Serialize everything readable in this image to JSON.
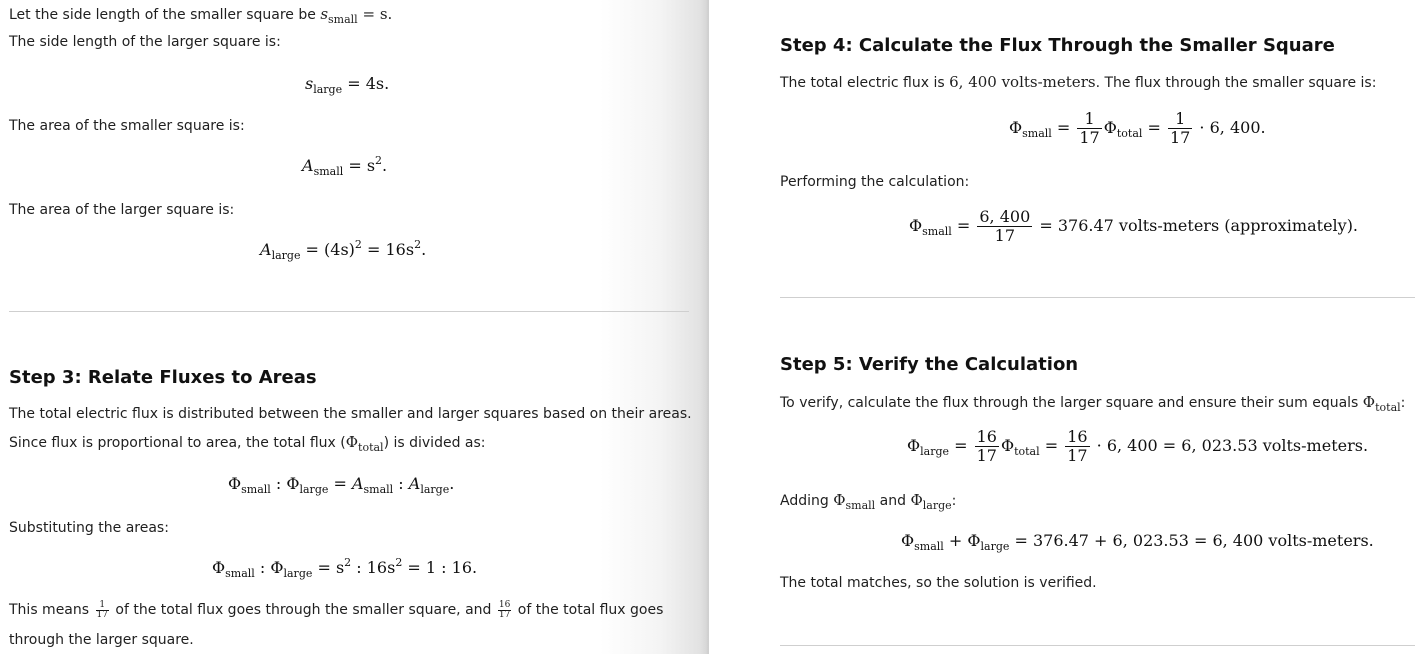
{
  "left_panel": {
    "intro_line1_text": "Let the side length of the smaller square be ",
    "intro_line1_math": {
      "var": "s",
      "sub": "small",
      "rhs": "= s."
    },
    "intro_line2": "The side length of the larger square is:",
    "eq_side_large": {
      "var": "s",
      "sub": "large",
      "rhs": "= 4s."
    },
    "area_small_label": "The area of the smaller square is:",
    "eq_area_small": {
      "var": "A",
      "sub": "small",
      "rhs": "= s",
      "exp": "2",
      "end": "."
    },
    "area_large_label": "The area of the larger square is:",
    "eq_area_large": {
      "var": "A",
      "sub": "large",
      "mid": "= (4s)",
      "exp1": "2",
      "rhs": " = 16s",
      "exp2": "2",
      "end": "."
    },
    "step3": {
      "heading": "Step 3: Relate Fluxes to Areas",
      "para1": "The total electric flux is distributed between the smaller and larger squares based on their areas.",
      "para2_pre": "Since flux is proportional to area, the total flux (",
      "para2_sym": "Φ",
      "para2_sub": "total",
      "para2_post": ") is divided as:",
      "eq_ratio": {
        "phi": "Φ",
        "sub1": "small",
        "colon1": " : ",
        "sub2": "large",
        "eq": " = ",
        "a": "A",
        "sub3": "small",
        "colon2": " : ",
        "sub4": "large",
        "end": "."
      },
      "subst_label": "Substituting the areas:",
      "eq_subst": {
        "phi": "Φ",
        "sub1": "small",
        "colon": " : ",
        "sub2": "large",
        "rhs1": " = s",
        "exp1": "2",
        "rhs2": " : 16s",
        "exp2": "2",
        "rhs3": " = 1 : 16."
      },
      "conclusion_pre": "This means ",
      "frac1": {
        "num": "1",
        "den": "17"
      },
      "conclusion_mid": " of the total flux goes through the smaller square, and ",
      "frac2": {
        "num": "16",
        "den": "17"
      },
      "conclusion_post": " of the total flux goes",
      "conclusion_line2": "through the larger square."
    }
  },
  "right_panel": {
    "step4": {
      "heading": "Step 4: Calculate the Flux Through the Smaller Square",
      "para_pre": "The total electric flux is ",
      "para_value": "6, 400 volts-meters",
      "para_post": ". The flux through the smaller square is:",
      "eq1": {
        "phi": "Φ",
        "sub": "small",
        "eq": " = ",
        "frac": {
          "num": "1",
          "den": "17"
        },
        "phi2": "Φ",
        "sub2": "total",
        "eq2": " = ",
        "frac2": {
          "num": "1",
          "den": "17"
        },
        "rhs": " · 6, 400."
      },
      "calc_label": "Performing the calculation:",
      "eq2": {
        "phi": "Φ",
        "sub": "small",
        "eq": " = ",
        "frac": {
          "num": "6, 400",
          "den": "17"
        },
        "rhs": " = 376.47 volts-meters (approximately)."
      }
    },
    "step5": {
      "heading": "Step 5: Verify the Calculation",
      "para_pre": "To verify, calculate the flux through the larger square and ensure their sum equals ",
      "para_sym": "Φ",
      "para_sub": "total",
      "para_post": ":",
      "eq1": {
        "phi": "Φ",
        "sub": "large",
        "eq": " = ",
        "frac": {
          "num": "16",
          "den": "17"
        },
        "phi2": "Φ",
        "sub2": "total",
        "eq2": " = ",
        "frac2": {
          "num": "16",
          "den": "17"
        },
        "rhs": " · 6, 400 = 6, 023.53 volts-meters."
      },
      "adding_pre": "Adding ",
      "adding_sub1": "small",
      "adding_mid": " and ",
      "adding_sub2": "large",
      "adding_post": ":",
      "eq2": {
        "phi": "Φ",
        "sub1": "small",
        "plus": " + ",
        "sub2": "large",
        "rhs": " = 376.47 + 6, 023.53 = 6, 400 volts-meters."
      },
      "conclusion": "The total matches, so the solution is verified."
    }
  }
}
